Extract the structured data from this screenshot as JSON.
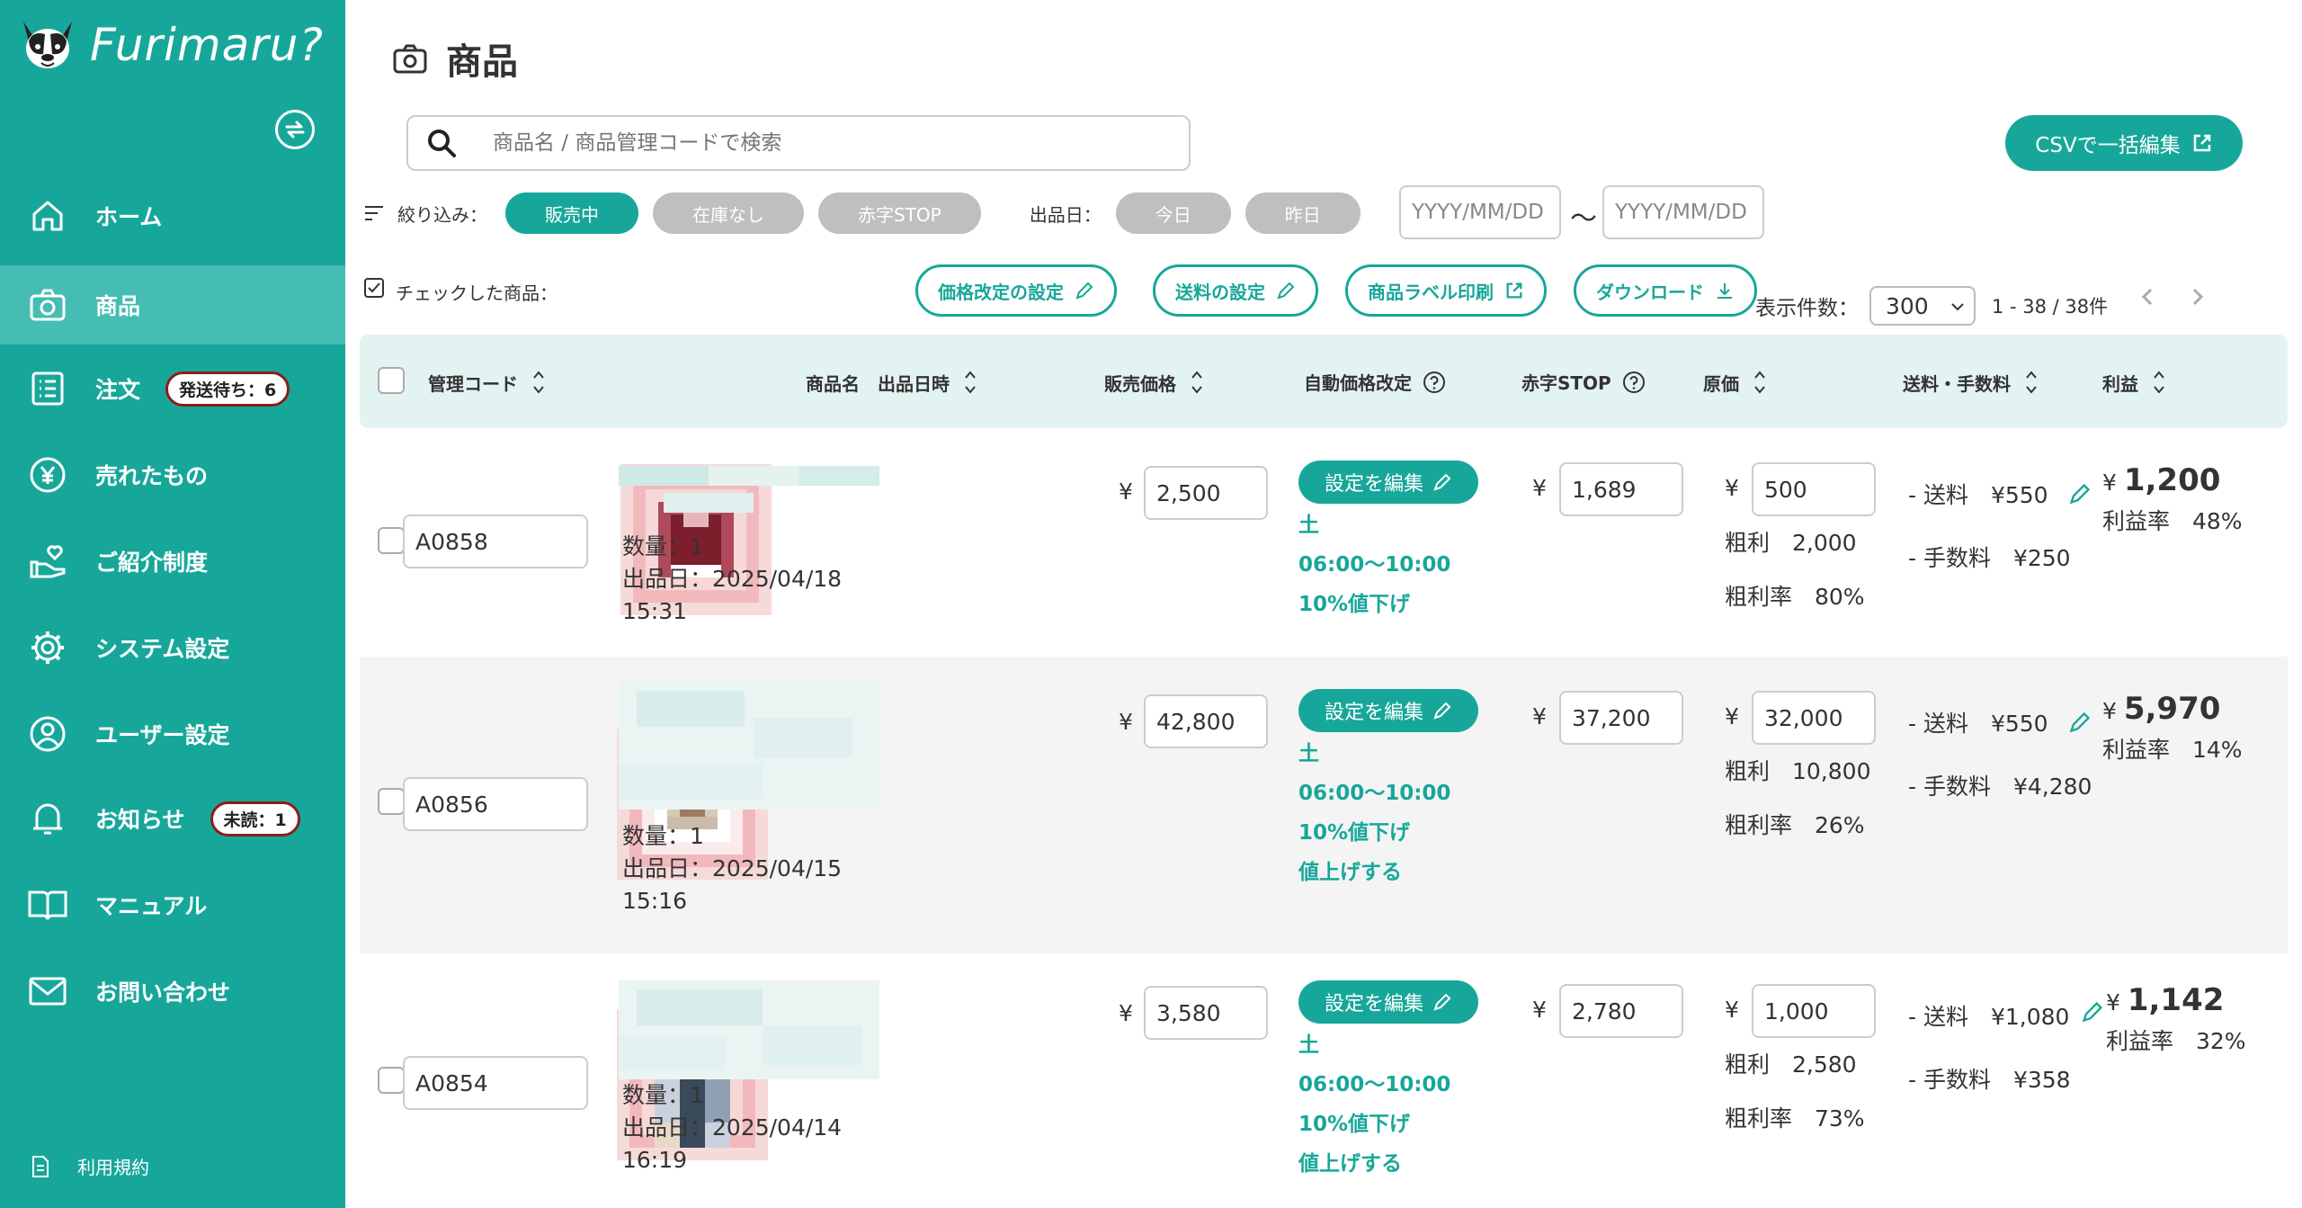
{
  "app": {
    "name": "Furimaru?"
  },
  "sidebar": {
    "items": [
      {
        "label": "ホーム"
      },
      {
        "label": "商品"
      },
      {
        "label": "注文",
        "badge": "発送待ち：6"
      },
      {
        "label": "売れたもの"
      },
      {
        "label": "ご紹介制度"
      },
      {
        "label": "システム設定"
      },
      {
        "label": "ユーザー設定"
      },
      {
        "label": "お知らせ",
        "badge": "未読：1"
      },
      {
        "label": "マニュアル"
      },
      {
        "label": "お問い合わせ"
      }
    ],
    "terms": "利用規約"
  },
  "page": {
    "title": "商品"
  },
  "search": {
    "placeholder": "商品名 / 商品管理コードで検索"
  },
  "csv_button": "CSVで一括編集",
  "filter": {
    "label": "絞り込み：",
    "chips": [
      "販売中",
      "在庫なし",
      "赤字STOP"
    ],
    "date_label": "出品日：",
    "date_chips": [
      "今日",
      "昨日"
    ],
    "date_from_placeholder": "YYYY/MM/DD",
    "date_to_placeholder": "YYYY/MM/DD",
    "tilde": "〜"
  },
  "bulk": {
    "label": "チェックした商品：",
    "buttons": [
      "価格改定の設定",
      "送料の設定",
      "商品ラベル印刷",
      "ダウンロード"
    ]
  },
  "pagination": {
    "per_page_label": "表示件数：",
    "per_page": "300",
    "range": "1 - 38 / 38件"
  },
  "table": {
    "headers": {
      "code": "管理コード",
      "name": "商品名",
      "listed": "出品日時",
      "price": "販売価格",
      "auto": "自動価格改定",
      "stop": "赤字STOP",
      "cost": "原価",
      "fee": "送料・手数料",
      "profit": "利益"
    },
    "yen": "¥",
    "rows": [
      {
        "code": "A0858",
        "qty": "数量：1",
        "date": "出品日：2025/04/18",
        "time": "15:31",
        "price": "2,500",
        "edit": "設定を編集",
        "rule_day": "土",
        "rule_time": "06:00〜10:00",
        "rule_action": "10%値下げ",
        "rule_extra": "",
        "stop": "1,689",
        "cost": "500",
        "gross": "粗利　2,000",
        "gross_rate": "粗利率　80%",
        "ship": "- 送料　¥550",
        "fee": "- 手数料　¥250",
        "profit": "1,200",
        "profit_rate": "利益率　48%"
      },
      {
        "code": "A0856",
        "qty": "数量：1",
        "date": "出品日：2025/04/15",
        "time": "15:16",
        "price": "42,800",
        "edit": "設定を編集",
        "rule_day": "土",
        "rule_time": "06:00〜10:00",
        "rule_action": "10%値下げ",
        "rule_extra": "値上げする",
        "stop": "37,200",
        "cost": "32,000",
        "gross": "粗利　10,800",
        "gross_rate": "粗利率　26%",
        "ship": "- 送料　¥550",
        "fee": "- 手数料　¥4,280",
        "profit": "5,970",
        "profit_rate": "利益率　14%"
      },
      {
        "code": "A0854",
        "qty": "数量：1",
        "date": "出品日：2025/04/14",
        "time": "16:19",
        "price": "3,580",
        "edit": "設定を編集",
        "rule_day": "土",
        "rule_time": "06:00〜10:00",
        "rule_action": "10%値下げ",
        "rule_extra": "値上げする",
        "stop": "2,780",
        "cost": "1,000",
        "gross": "粗利　2,580",
        "gross_rate": "粗利率　73%",
        "ship": "- 送料　¥1,080",
        "fee": "- 手数料　¥358",
        "profit": "1,142",
        "profit_rate": "利益率　32%"
      }
    ]
  }
}
